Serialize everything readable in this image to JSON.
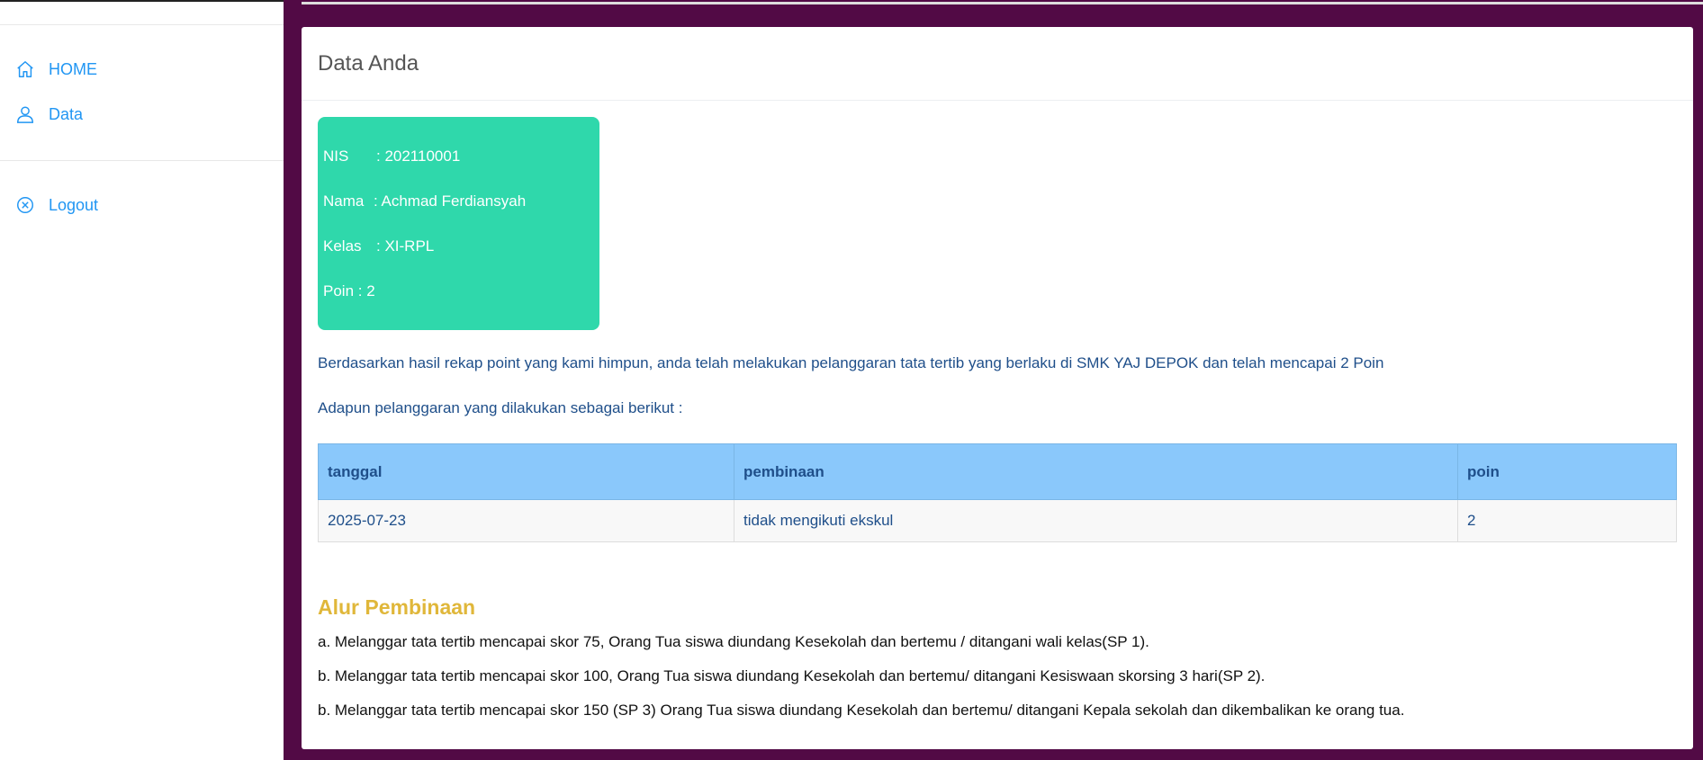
{
  "sidebar": {
    "items": [
      {
        "label": "HOME",
        "icon": "home-icon"
      },
      {
        "label": "Data",
        "icon": "user-icon"
      }
    ],
    "logout": {
      "label": "Logout",
      "icon": "close-circle-icon"
    }
  },
  "card": {
    "title": "Data Anda",
    "student": {
      "nis_key": "NIS",
      "nis_val": ": 202110001",
      "nama_key": "Nama",
      "nama_val": ": Achmad Ferdiansyah",
      "kelas_key": "Kelas",
      "kelas_val": ": XI-RPL",
      "poin_text": "Poin : 2"
    },
    "summary_text": "Berdasarkan hasil rekap point yang kami himpun, anda telah melakukan pelanggaran tata tertib yang berlaku di SMK YAJ DEPOK dan telah mencapai 2 Poin",
    "list_intro": "Adapun pelanggaran yang dilakukan sebagai berikut :",
    "table": {
      "headers": [
        "tanggal",
        "pembinaan",
        "poin"
      ],
      "rows": [
        [
          "2025-07-23",
          "tidak mengikuti ekskul",
          "2"
        ]
      ]
    },
    "alur": {
      "title": "Alur Pembinaan",
      "rules": [
        "a. Melanggar tata tertib mencapai skor 75, Orang Tua siswa diundang Kesekolah dan bertemu / ditangani wali kelas(SP 1).",
        "b. Melanggar tata tertib mencapai skor 100, Orang Tua siswa diundang Kesekolah dan bertemu/ ditangani Kesiswaan skorsing 3 hari(SP 2).",
        "b. Melanggar tata tertib mencapai skor 150 (SP 3) Orang Tua siswa diundang Kesekolah dan bertemu/ ditangani Kepala sekolah dan dikembalikan ke orang tua."
      ]
    }
  },
  "colors": {
    "main_bg": "#520a45",
    "accent_blue": "#2196f3",
    "info_box": "#2fd8ab",
    "table_header": "#8ac8fb",
    "section_title": "#e0b73a"
  }
}
